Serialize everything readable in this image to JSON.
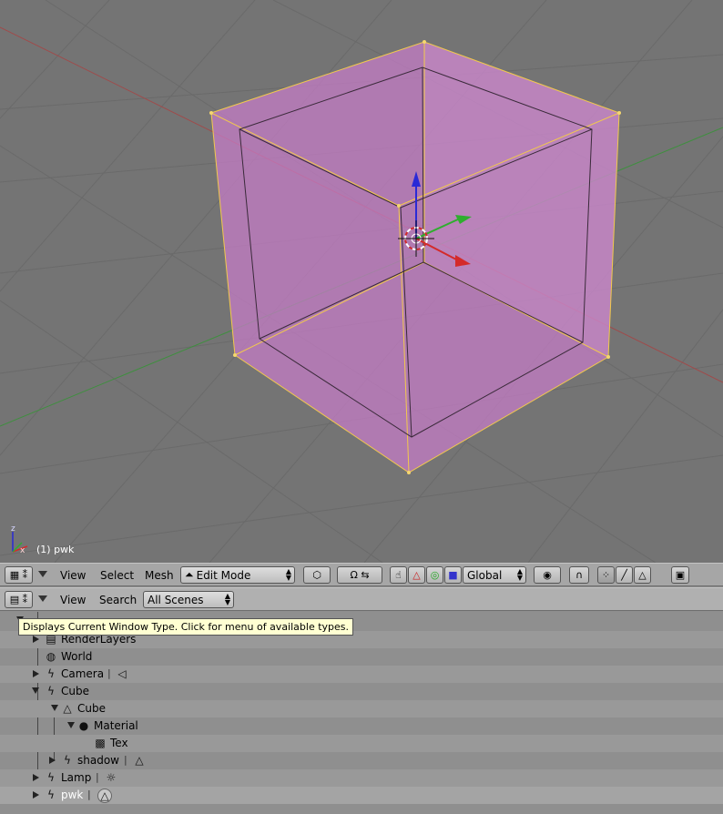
{
  "viewport": {
    "object_label": "(1) pwk",
    "colors": {
      "background": "#747474",
      "grid": "#6a6a6a",
      "x_axis": "#a04a4a",
      "y_axis": "#3f8f3f",
      "face": "#c77dc9",
      "edge_selected": "#f2c94c"
    }
  },
  "viewport_header": {
    "menus": [
      "View",
      "Select",
      "Mesh"
    ],
    "mode": "Edit Mode",
    "orientation": "Global"
  },
  "outliner_header": {
    "menus": [
      "View",
      "Search"
    ],
    "filter": "All Scenes"
  },
  "tooltip": "Displays Current Window Type. Click for menu of available types.",
  "outliner": {
    "rows": [
      {
        "label": "RenderLayers"
      },
      {
        "label": "World"
      },
      {
        "label": "Camera"
      },
      {
        "label": "Cube"
      },
      {
        "label": "Cube"
      },
      {
        "label": "Material"
      },
      {
        "label": "Tex"
      },
      {
        "label": "shadow"
      },
      {
        "label": "Lamp"
      },
      {
        "label": "pwk"
      }
    ]
  }
}
